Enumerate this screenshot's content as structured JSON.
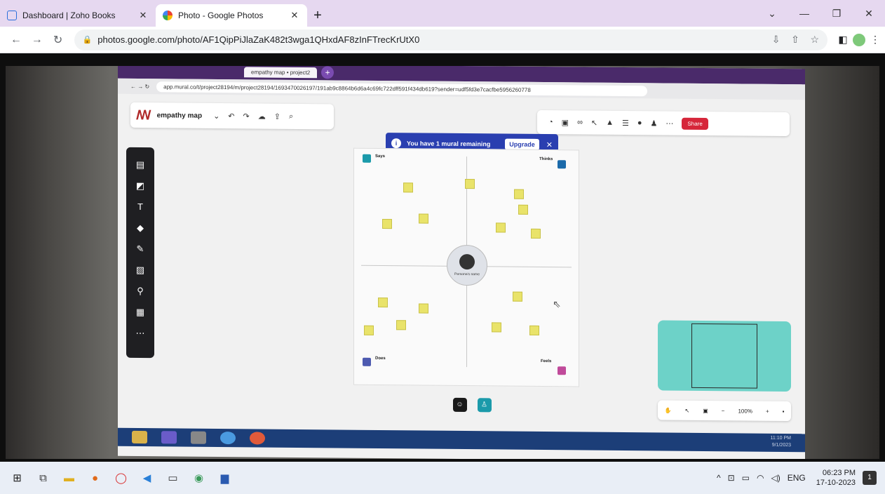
{
  "browser": {
    "tabs": [
      {
        "label": "Dashboard | Zoho Books",
        "close": "✕"
      },
      {
        "label": "Photo - Google Photos",
        "close": "✕"
      }
    ],
    "new_tab": "+",
    "url": "photos.google.com/photo/AF1QipPiJlaZaK482t3wga1QHxdAF8zInFTrecKrUtX0"
  },
  "photo_content": {
    "mural_tab": "empathy map • project2",
    "mural_url": "app.mural.co/t/project28194/m/project28194/1693470026197/191ab9c8864b6d6a4c69fc722dff591f434db619?sender=udf5fd3e7cacfbe5956260778",
    "mural_name": "empathy map",
    "banner_text": "You have 1 mural remaining",
    "upgrade_label": "Upgrade",
    "share_label": "Share",
    "quadrants": {
      "top_left": "Says",
      "top_right": "Thinks",
      "bottom_left": "Does",
      "bottom_right": "Feels"
    },
    "persona_label": "Persona's name",
    "zoom": "100%",
    "inner_time": "11:10 PM",
    "inner_date": "9/1/2023"
  },
  "taskbar": {
    "language": "ENG",
    "time": "06:23 PM",
    "date": "17-10-2023",
    "notifications": "1"
  },
  "colors": {
    "tab_strip": "#e6d8f0",
    "mural_banner": "#2a3fb0",
    "share": "#d6263a",
    "minimap": "#6dd2c8",
    "sticky": "#e9e36a"
  }
}
